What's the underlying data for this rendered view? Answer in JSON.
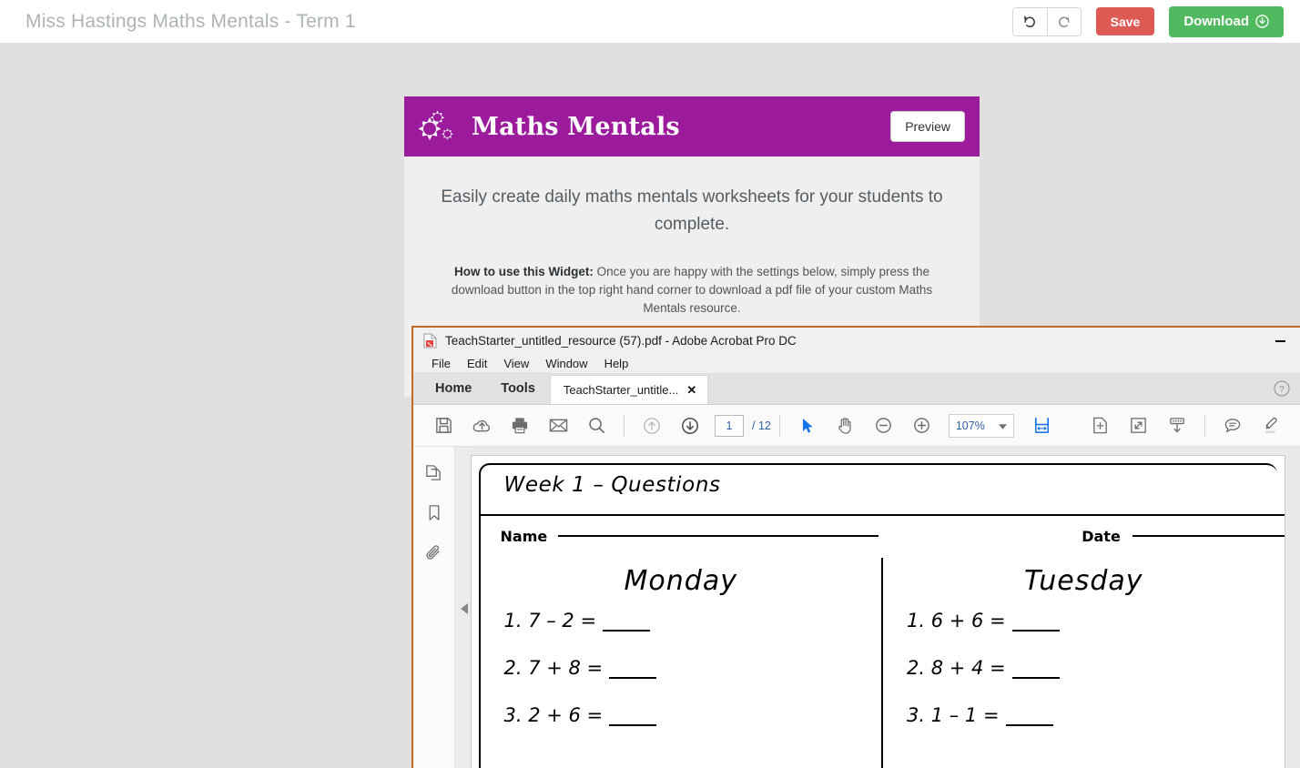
{
  "app": {
    "title": "Miss Hastings Maths Mentals - Term 1",
    "undo_label": "undo-icon",
    "redo_label": "redo-icon",
    "save_label": "Save",
    "download_label": "Download",
    "colors": {
      "save": "#dd5a55",
      "download": "#51b95f",
      "widget_header": "#9c1a9c",
      "title_text": "#aeb3b7"
    }
  },
  "widget": {
    "logo_icon": "gears-icon",
    "name": "Maths Mentals",
    "preview_label": "Preview",
    "tagline": "Easily create daily maths mentals worksheets for your students to complete.",
    "howto_label": "How to use this Widget:",
    "howto_text": " Once you are happy with the settings below, simply press the download button in the top right hand corner to download a pdf file of your custom Maths Mentals resource."
  },
  "acrobat": {
    "window_title": "TeachStarter_untitled_resource (57).pdf - Adobe Acrobat Pro DC",
    "minimize_label": "minimize-icon",
    "menus": [
      "File",
      "Edit",
      "View",
      "Window",
      "Help"
    ],
    "nav_tabs": [
      "Home",
      "Tools"
    ],
    "doc_tab": {
      "label": "TeachStarter_untitle...",
      "close": "✕"
    },
    "help_icon": "help-circle-icon",
    "toolbar": {
      "left_icons": [
        "save-icon",
        "upload-cloud-icon",
        "print-icon",
        "email-icon",
        "search-icon"
      ],
      "prev_page_icon": "previous-page-icon",
      "next_page_icon": "next-page-icon",
      "page_current": "1",
      "page_total": "/ 12",
      "select_icon": "select-cursor-icon",
      "hand_icon": "hand-tool-icon",
      "zoom_out_icon": "zoom-out-icon",
      "zoom_in_icon": "zoom-in-icon",
      "zoom_value": "107%",
      "zoom_caret": "chevron-down-icon",
      "fit_width_icon": "fit-width-icon",
      "fit_page_icon": "fit-page-icon",
      "fullscreen_icon": "fullscreen-icon",
      "toolbar_toggle_icon": "show-toolbar-icon",
      "comment_icon": "comment-icon",
      "highlight_icon": "highlighter-icon"
    },
    "sidebar_icons": [
      "page-thumbnails-icon",
      "bookmarks-icon",
      "attachments-icon"
    ],
    "collapse_icon": "collapse-panel-icon"
  },
  "worksheet": {
    "title": "Week 1 – Questions",
    "name_label": "Name",
    "date_label": "Date",
    "columns": [
      {
        "day": "Monday",
        "questions": [
          "1. 7 – 2 =",
          "2. 7 + 8 =",
          "3. 2 + 6 ="
        ]
      },
      {
        "day": "Tuesday",
        "questions": [
          "1. 6 + 6 =",
          "2. 8 + 4 =",
          "3. 1 – 1 ="
        ]
      }
    ]
  }
}
